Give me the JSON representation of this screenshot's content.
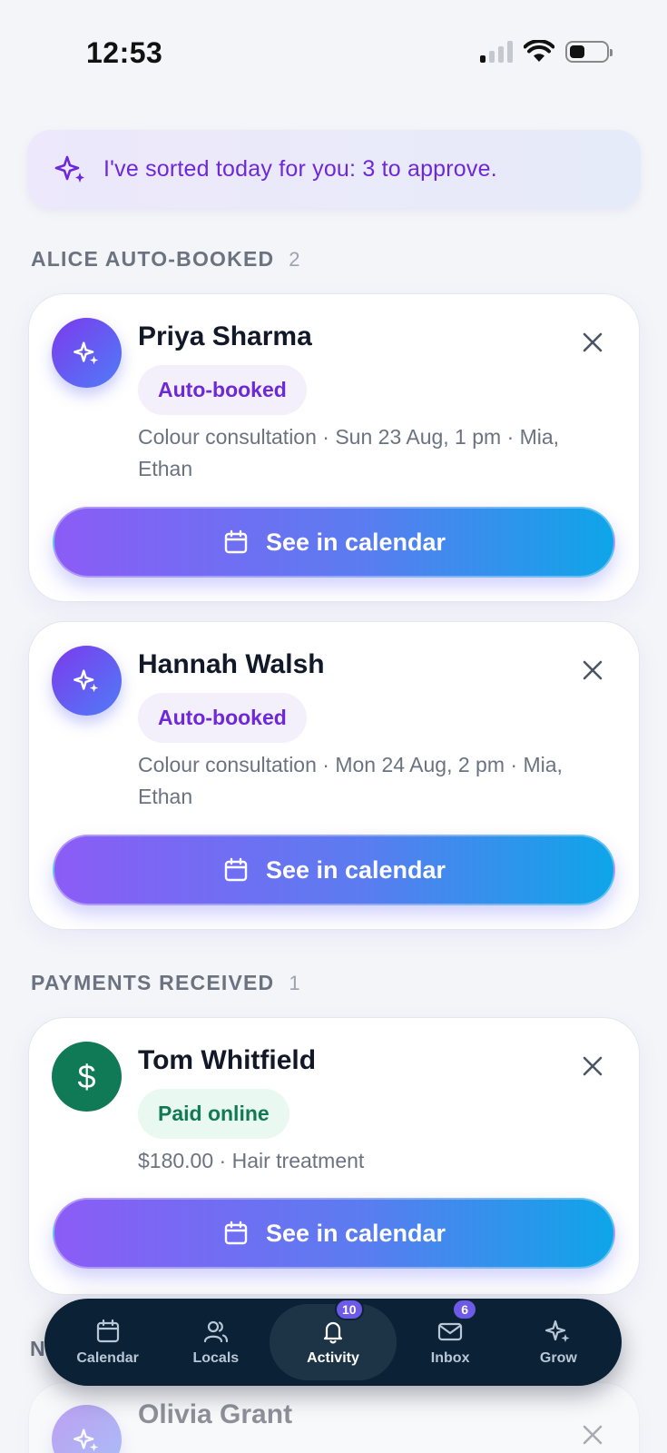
{
  "status_bar": {
    "time": "12:53"
  },
  "banner": {
    "text": "I've sorted today for you: 3 to approve.",
    "icon": "sparkles-icon"
  },
  "sections": {
    "auto_booked": {
      "title": "ALICE AUTO-BOOKED",
      "count": "2"
    },
    "payments": {
      "title": "PAYMENTS RECEIVED",
      "count": "1"
    },
    "partial_next": {
      "title": "N"
    }
  },
  "cards": [
    {
      "name": "Priya Sharma",
      "badge": "Auto-booked",
      "detail": "Colour consultation · Sun 23 Aug, 1 pm · Mia, Ethan",
      "cta": "See in calendar"
    },
    {
      "name": "Hannah Walsh",
      "badge": "Auto-booked",
      "detail": "Colour consultation · Mon 24 Aug, 2 pm · Mia, Ethan",
      "cta": "See in calendar"
    },
    {
      "name": "Tom Whitfield",
      "avatar_symbol": "$",
      "badge": "Paid online",
      "detail": "$180.00 · Hair treatment",
      "cta": "See in calendar"
    },
    {
      "name": "Olivia Grant"
    }
  ],
  "nav": [
    {
      "label": "Calendar",
      "icon": "calendar-icon"
    },
    {
      "label": "Locals",
      "icon": "users-icon"
    },
    {
      "label": "Activity",
      "icon": "bell-icon",
      "badge": "10",
      "active": true
    },
    {
      "label": "Inbox",
      "icon": "mail-icon",
      "badge": "6"
    },
    {
      "label": "Grow",
      "icon": "sparkles-icon"
    }
  ],
  "colors": {
    "accent_purple": "#6d28d9",
    "gradient_start": "#8b5cf6",
    "gradient_end": "#0ea5e9",
    "paid_green": "#0f7a55",
    "nav_bg": "#0b2236"
  }
}
